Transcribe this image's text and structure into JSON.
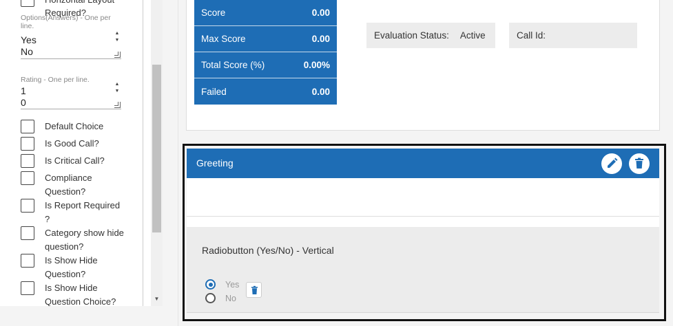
{
  "sidebar": {
    "top_checkbox_label": "Horizontal Layout Required?",
    "options": {
      "label": "Options(Answers) - One per line.",
      "values": [
        "Yes",
        "No"
      ]
    },
    "rating": {
      "label": "Rating - One per line.",
      "values": [
        "1",
        "0"
      ]
    },
    "checkboxes": [
      {
        "label": "Default Choice"
      },
      {
        "label": "Is Good Call?"
      },
      {
        "label": "Is Critical Call?"
      },
      {
        "label": "Compliance Question?"
      },
      {
        "label": "Is Report Required ?"
      },
      {
        "label": "Category show hide question?"
      },
      {
        "label": "Is Show Hide Question?"
      },
      {
        "label": "Is Show Hide Question Choice?"
      }
    ]
  },
  "scores": [
    {
      "label": "Score",
      "value": "0.00"
    },
    {
      "label": "Max Score",
      "value": "0.00"
    },
    {
      "label": "Total Score (%)",
      "value": "0.00%"
    },
    {
      "label": "Failed",
      "value": "0.00"
    }
  ],
  "evaluation": {
    "status_label": "Evaluation Status:",
    "status_value": "Active",
    "call_id_label": "Call Id:"
  },
  "section": {
    "title": "Greeting",
    "question": {
      "title": "Radiobutton (Yes/No) - Vertical",
      "choices": [
        {
          "label": "Yes",
          "checked": true
        },
        {
          "label": "No",
          "checked": false
        }
      ]
    }
  },
  "colors": {
    "primary": "#1e6db5",
    "panel_gray": "#ececec"
  },
  "icons": {
    "edit": "pencil-icon",
    "delete": "trash-icon",
    "checkbox": "checkbox-icon"
  }
}
